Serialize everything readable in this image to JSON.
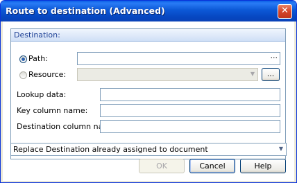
{
  "window": {
    "title": "Route to destination (Advanced)"
  },
  "icons": {
    "close": "close-icon",
    "browse": "ellipsis-icon",
    "dropdown": "chevron-down-icon"
  },
  "group": {
    "header": "Destination:"
  },
  "path": {
    "label": "Path:",
    "value": "",
    "selected": true,
    "browse_label": "···"
  },
  "resource": {
    "label": "Resource:",
    "value": "",
    "selected": false,
    "browse_label": "..."
  },
  "lookup": {
    "label": "Lookup data:",
    "value": ""
  },
  "key_column": {
    "label": "Key column name:",
    "value": ""
  },
  "destination_column": {
    "label": "Destination column name:",
    "value": ""
  },
  "mode": {
    "value": "Replace Destination already assigned to document"
  },
  "buttons": {
    "ok": "OK",
    "cancel": "Cancel",
    "help": "Help"
  },
  "colors": {
    "titlebar": "#0a5fe6",
    "group_header_text": "#1c3f94",
    "border": "#7f9db9"
  }
}
